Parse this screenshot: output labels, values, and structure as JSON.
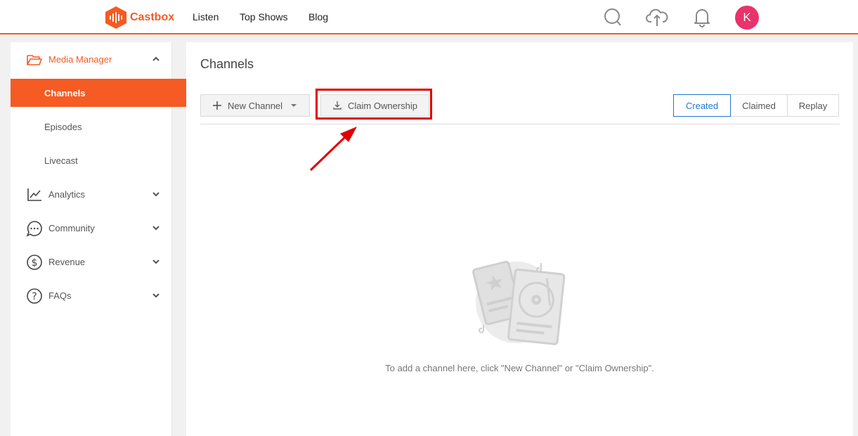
{
  "brand": {
    "name": "Castbox",
    "accent": "#f55b23"
  },
  "nav": {
    "listen": "Listen",
    "top_shows": "Top Shows",
    "blog": "Blog"
  },
  "user": {
    "initial": "K",
    "avatar_color": "#e8336b"
  },
  "sidebar": {
    "media_manager": "Media Manager",
    "channels": "Channels",
    "episodes": "Episodes",
    "livecast": "Livecast",
    "analytics": "Analytics",
    "community": "Community",
    "revenue": "Revenue",
    "faqs": "FAQs"
  },
  "main": {
    "title": "Channels",
    "new_channel": "New Channel",
    "claim_ownership": "Claim Ownership",
    "tabs": [
      "Created",
      "Claimed",
      "Replay"
    ],
    "active_tab": "Created",
    "empty_message": "To add a channel here, click \"New Channel\" or \"Claim Ownership\"."
  },
  "annotation": {
    "highlight_color": "#e00000"
  }
}
